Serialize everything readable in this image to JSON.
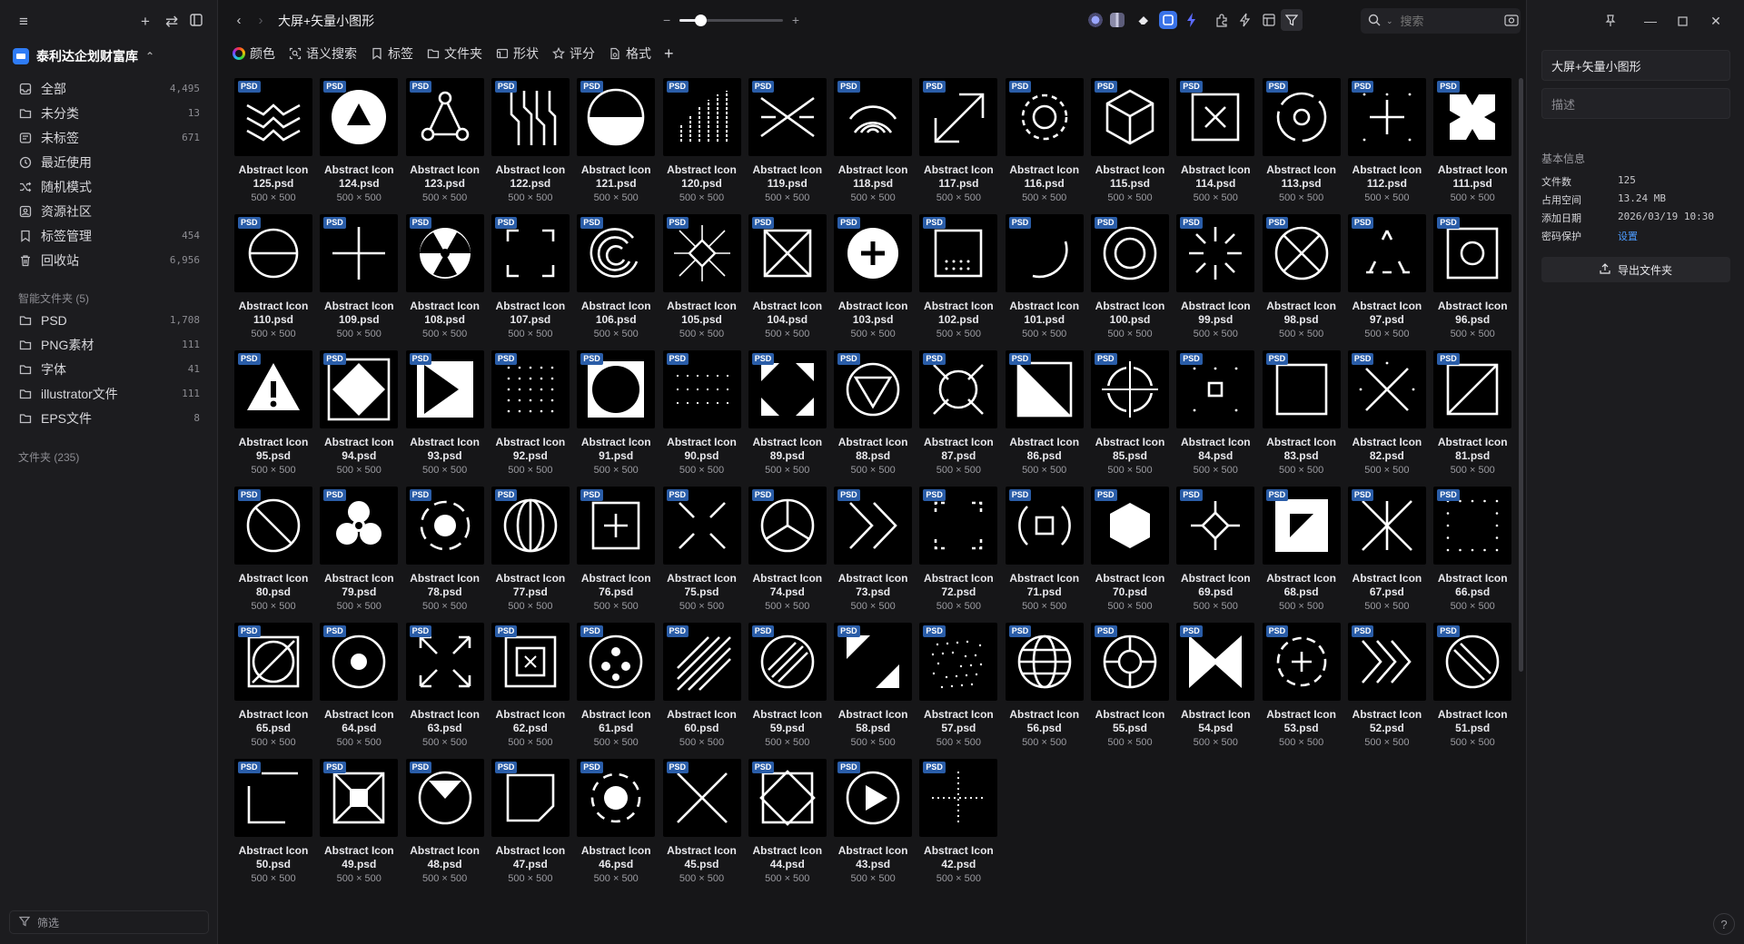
{
  "sidebar": {
    "library_name": "泰利达企划财富库",
    "nav": [
      {
        "label": "全部",
        "count": "4,495",
        "icon": "inbox-icon"
      },
      {
        "label": "未分类",
        "count": "13",
        "icon": "folder-outline-icon"
      },
      {
        "label": "未标签",
        "count": "671",
        "icon": "tag-outline-icon"
      },
      {
        "label": "最近使用",
        "count": "",
        "icon": "clock-icon"
      },
      {
        "label": "随机模式",
        "count": "",
        "icon": "shuffle-icon"
      },
      {
        "label": "资源社区",
        "count": "",
        "icon": "community-icon"
      },
      {
        "label": "标签管理",
        "count": "454",
        "icon": "bookmark-icon"
      },
      {
        "label": "回收站",
        "count": "6,956",
        "icon": "trash-icon"
      }
    ],
    "smart_folders_title": "智能文件夹 (5)",
    "smart_folders": [
      {
        "label": "PSD",
        "count": "1,708"
      },
      {
        "label": "PNG素材",
        "count": "111"
      },
      {
        "label": "字体",
        "count": "41"
      },
      {
        "label": "illustrator文件",
        "count": "111"
      },
      {
        "label": "EPS文件",
        "count": "8"
      }
    ],
    "folders_title": "文件夹 (235)",
    "filter_placeholder": "筛选"
  },
  "toolbar": {
    "title": "大屏+矢量小图形",
    "zoom_minus": "−",
    "zoom_plus": "+",
    "zoom_level": 0.2,
    "search_placeholder": "搜索"
  },
  "filters": [
    {
      "label": "颜色",
      "icon": "color-wheel-icon"
    },
    {
      "label": "语义搜索",
      "icon": "semantic-search-icon"
    },
    {
      "label": "标签",
      "icon": "bookmark-icon"
    },
    {
      "label": "文件夹",
      "icon": "folder-icon"
    },
    {
      "label": "形状",
      "icon": "shape-icon"
    },
    {
      "label": "评分",
      "icon": "star-icon"
    },
    {
      "label": "格式",
      "icon": "file-format-icon"
    }
  ],
  "grid": {
    "badge": "PSD",
    "name_prefix": "Abstract Icon",
    "size_label": "500 × 500",
    "start_number": 125,
    "count": 84
  },
  "panel": {
    "name_value": "大屏+矢量小图形",
    "desc_placeholder": "描述",
    "info_title": "基本信息",
    "info": [
      {
        "key": "文件数",
        "value": "125"
      },
      {
        "key": "占用空间",
        "value": "13.24 MB"
      },
      {
        "key": "添加日期",
        "value": "2026/03/19 10:30"
      },
      {
        "key": "密码保护",
        "value": "设置"
      }
    ],
    "export_label": "导出文件夹",
    "help": "?"
  },
  "colors": {
    "accent": "#2f7cf6",
    "badge": "#2a5da8",
    "link": "#4d9cff"
  }
}
